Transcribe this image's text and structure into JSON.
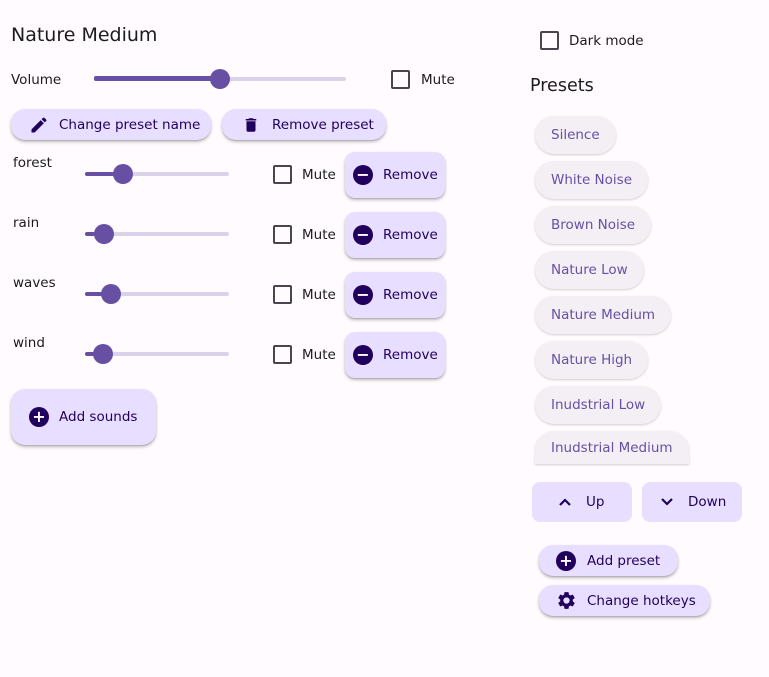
{
  "header": {
    "title": "Nature Medium"
  },
  "volume": {
    "label": "Volume",
    "value": 0.5,
    "mute_label": "Mute"
  },
  "preset_actions": {
    "change_name": "Change preset name",
    "remove": "Remove preset"
  },
  "sounds": [
    {
      "name": "forest",
      "level": 0.27,
      "mute_label": "Mute",
      "remove_label": "Remove"
    },
    {
      "name": "rain",
      "level": 0.1,
      "mute_label": "Mute",
      "remove_label": "Remove"
    },
    {
      "name": "waves",
      "level": 0.18,
      "mute_label": "Mute",
      "remove_label": "Remove"
    },
    {
      "name": "wind",
      "level": 0.12,
      "mute_label": "Mute",
      "remove_label": "Remove"
    }
  ],
  "add_sounds_label": "Add sounds",
  "dark_mode_label": "Dark mode",
  "presets": {
    "heading": "Presets",
    "items": [
      "Silence",
      "White Noise",
      "Brown Noise",
      "Nature Low",
      "Nature Medium",
      "Nature High",
      "Inudstrial Low",
      "Inudstrial Medium"
    ],
    "up_label": "Up",
    "down_label": "Down",
    "add_label": "Add preset",
    "hotkeys_label": "Change hotkeys"
  },
  "colors": {
    "accent": "#6750a4",
    "button_bg": "#e8deff",
    "button_text": "#21005d",
    "background": "#fffbfe"
  }
}
